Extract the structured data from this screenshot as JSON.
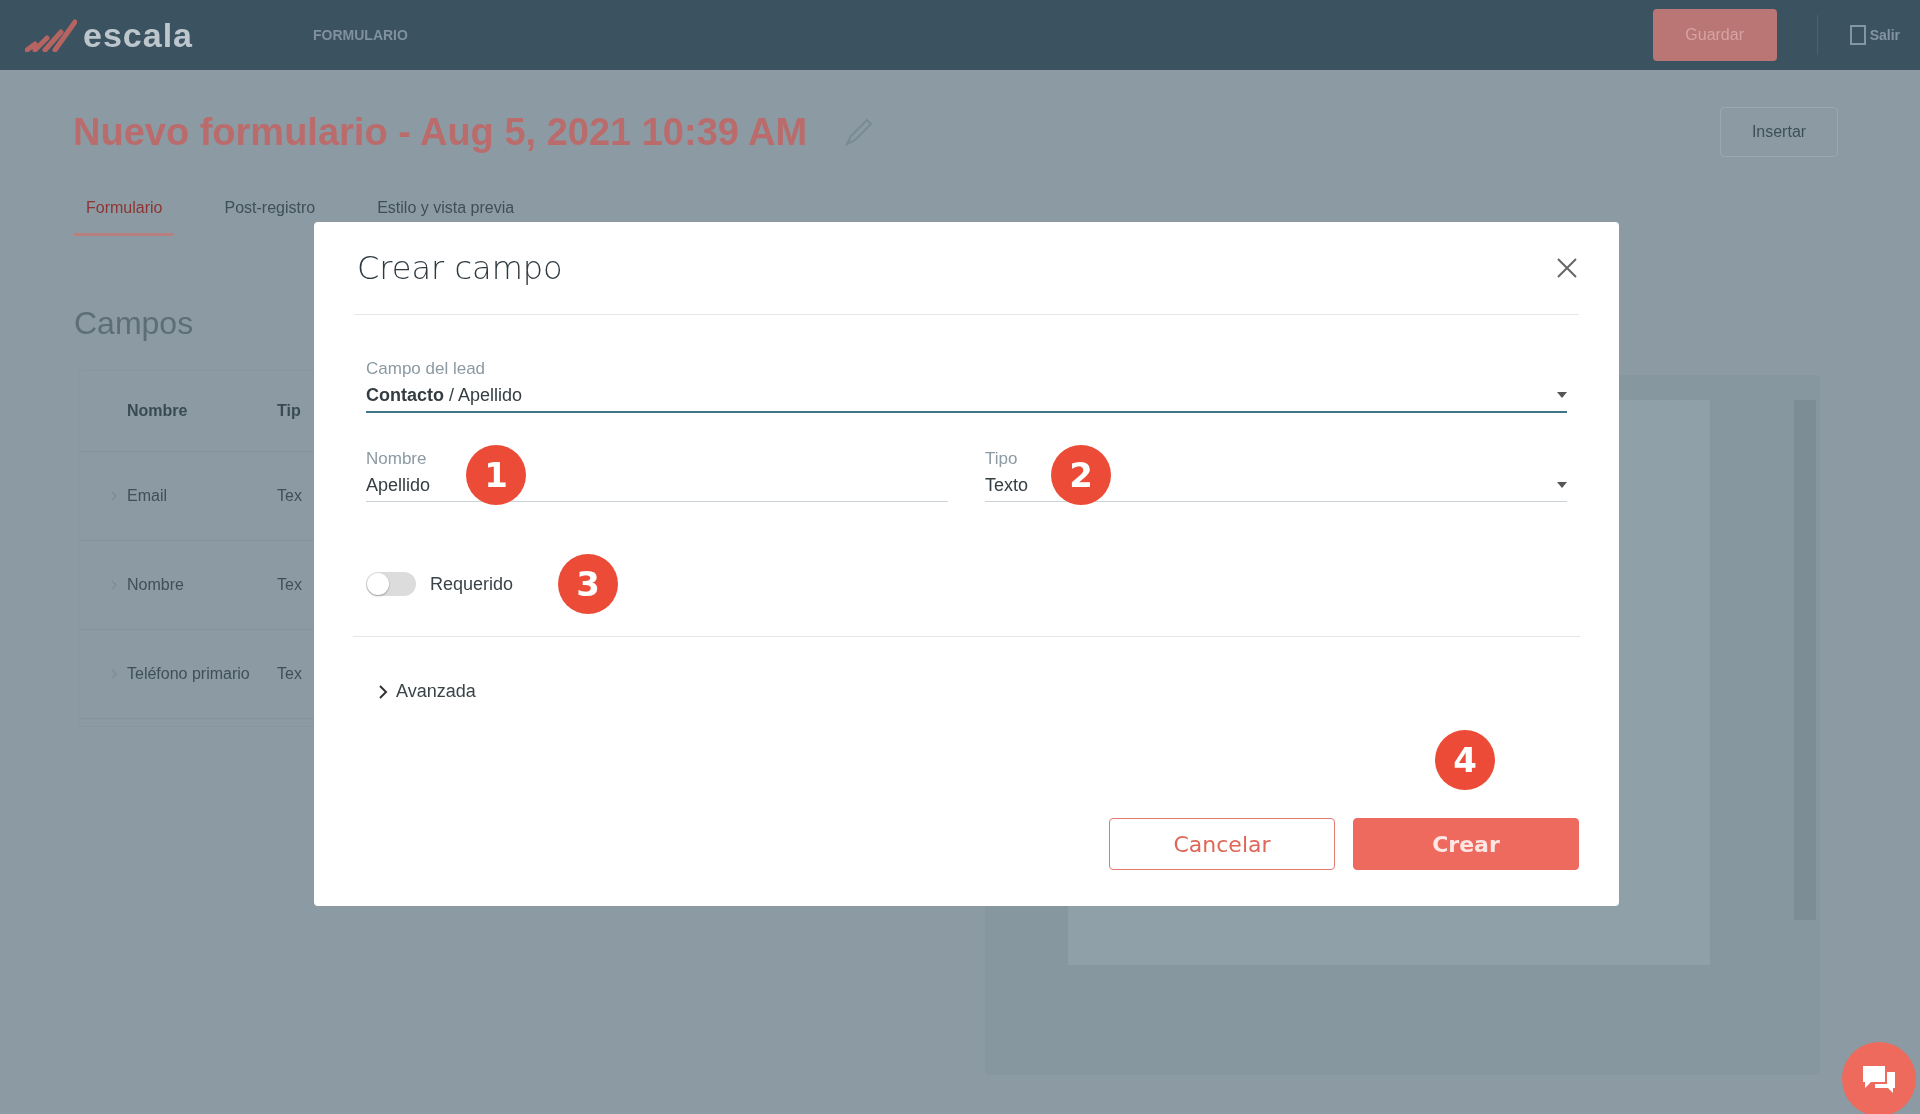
{
  "topbar": {
    "logo": "escala",
    "section": "FORMULARIO",
    "save_button": "Guardar",
    "exit_link": "Salir"
  },
  "page": {
    "title": "Nuevo formulario - Aug 5, 2021 10:39 AM",
    "insert_button": "Insertar",
    "tabs": [
      {
        "label": "Formulario",
        "selected": true
      },
      {
        "label": "Post-registro",
        "selected": false
      },
      {
        "label": "Estilo y vista previa",
        "selected": false
      }
    ],
    "section_title": "Campos",
    "table": {
      "columns": [
        "Nombre",
        "Tip"
      ],
      "rows": [
        {
          "cells": [
            "Email",
            "Tex"
          ]
        },
        {
          "cells": [
            "Nombre",
            "Tex"
          ]
        },
        {
          "cells": [
            "Teléfono primario",
            "Tex"
          ]
        }
      ]
    }
  },
  "dialog": {
    "title": "Crear campo",
    "lead_field": {
      "label": "Campo del lead",
      "value": "**Contacto** / Apellido"
    },
    "name_field": {
      "label": "Nombre",
      "value": "Apellido",
      "marker": "1"
    },
    "type_field": {
      "label": "Tipo",
      "value": "Texto",
      "marker": "2"
    },
    "required_toggle": {
      "label": "Requerido",
      "on": false,
      "marker": "3"
    },
    "advanced": {
      "label": "Avanzada",
      "expanded": false
    },
    "buttons": [
      {
        "label": "Cancelar",
        "kind": "secondary"
      },
      {
        "label": "Crear",
        "kind": "primary",
        "marker": "4"
      }
    ]
  }
}
